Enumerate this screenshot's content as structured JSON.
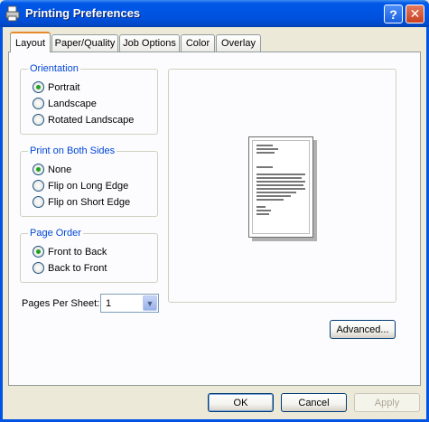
{
  "window": {
    "title": "Printing Preferences",
    "help_label": "?",
    "close_label": "✕"
  },
  "tabs": [
    {
      "label": "Layout",
      "active": true
    },
    {
      "label": "Paper/Quality",
      "active": false
    },
    {
      "label": "Job Options",
      "active": false
    },
    {
      "label": "Color",
      "active": false
    },
    {
      "label": "Overlay",
      "active": false
    }
  ],
  "orientation": {
    "title": "Orientation",
    "options": [
      {
        "label": "Portrait",
        "checked": true
      },
      {
        "label": "Landscape",
        "checked": false
      },
      {
        "label": "Rotated Landscape",
        "checked": false
      }
    ]
  },
  "both_sides": {
    "title": "Print on Both Sides",
    "options": [
      {
        "label": "None",
        "checked": true
      },
      {
        "label": "Flip on Long Edge",
        "checked": false
      },
      {
        "label": "Flip on Short Edge",
        "checked": false
      }
    ]
  },
  "page_order": {
    "title": "Page Order",
    "options": [
      {
        "label": "Front to Back",
        "checked": true
      },
      {
        "label": "Back to Front",
        "checked": false
      }
    ]
  },
  "pages_per_sheet": {
    "label": "Pages Per Sheet:",
    "value": "1"
  },
  "buttons": {
    "advanced": "Advanced...",
    "ok": "OK",
    "cancel": "Cancel",
    "apply": "Apply"
  },
  "colors": {
    "titlebar": "#0054e3",
    "group_title": "#0046d5",
    "dialog_bg": "#ece9d8",
    "tab_highlight": "#e68b2c"
  }
}
